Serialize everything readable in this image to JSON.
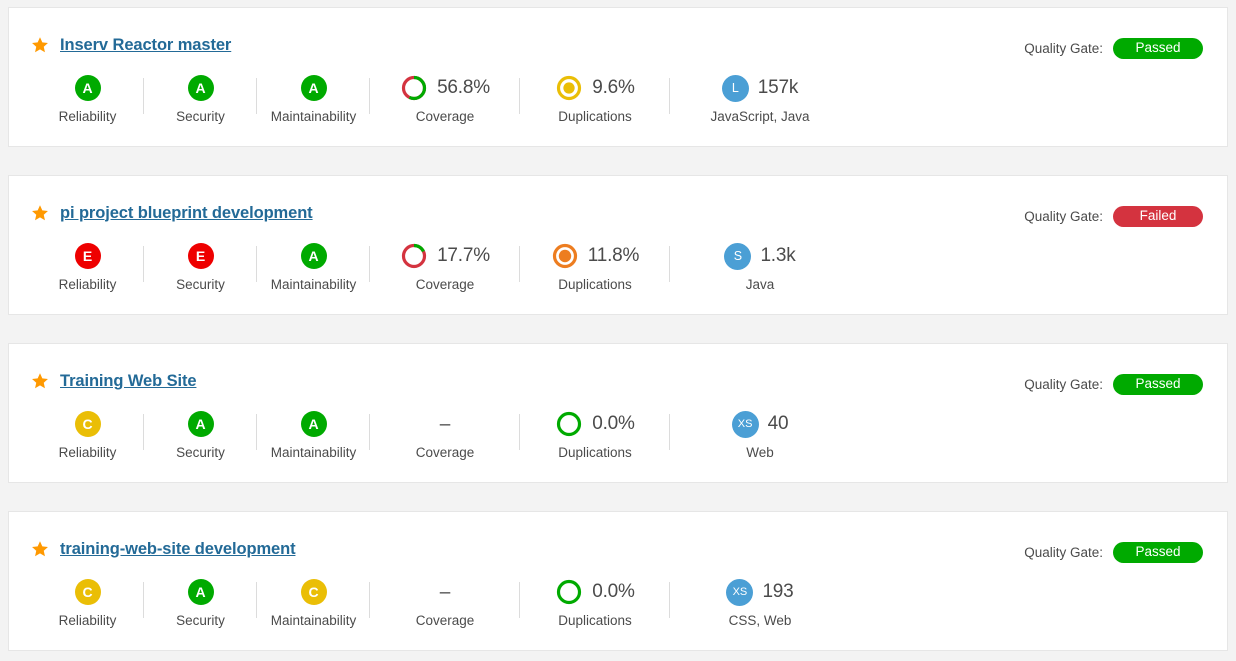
{
  "page": {
    "background_color": "#f3f3f3",
    "quality_gate_label": "Quality Gate:"
  },
  "colors": {
    "rating_a": "#00aa00",
    "rating_c": "#eabe06",
    "rating_e": "#ee0000",
    "gate_passed": "#00aa00",
    "gate_failed": "#d4333f",
    "link": "#236a97",
    "star": "#f90",
    "language_badge": "#4b9fd5",
    "coverage_good": "#00aa00",
    "coverage_bad": "#d4333f",
    "dup_low": "#eabe06",
    "dup_mid": "#ed7d20",
    "dup_none": "#00aa00"
  },
  "labels": {
    "reliability": "Reliability",
    "security": "Security",
    "maintainability": "Maintainability",
    "coverage": "Coverage",
    "duplications": "Duplications",
    "no_data": "–"
  },
  "projects": [
    {
      "name": "Inserv Reactor master",
      "favorite": true,
      "quality_gate": "Passed",
      "quality_gate_state": "passed",
      "reliability": "A",
      "security": "A",
      "maintainability": "A",
      "coverage": "56.8%",
      "coverage_pct": 56.8,
      "duplications": "9.6%",
      "duplications_pct": 9.6,
      "size_badge": "L",
      "ncloc": "157k",
      "languages": "JavaScript, Java"
    },
    {
      "name": "pi project blueprint development",
      "favorite": true,
      "quality_gate": "Failed",
      "quality_gate_state": "failed",
      "reliability": "E",
      "security": "E",
      "maintainability": "A",
      "coverage": "17.7%",
      "coverage_pct": 17.7,
      "duplications": "11.8%",
      "duplications_pct": 11.8,
      "size_badge": "S",
      "ncloc": "1.3k",
      "languages": "Java"
    },
    {
      "name": "Training Web Site",
      "favorite": true,
      "quality_gate": "Passed",
      "quality_gate_state": "passed",
      "reliability": "C",
      "security": "A",
      "maintainability": "A",
      "coverage": "–",
      "coverage_pct": null,
      "duplications": "0.0%",
      "duplications_pct": 0.0,
      "size_badge": "XS",
      "ncloc": "40",
      "languages": "Web"
    },
    {
      "name": "training-web-site development",
      "favorite": true,
      "quality_gate": "Passed",
      "quality_gate_state": "passed",
      "reliability": "C",
      "security": "A",
      "maintainability": "C",
      "coverage": "–",
      "coverage_pct": null,
      "duplications": "0.0%",
      "duplications_pct": 0.0,
      "size_badge": "XS",
      "ncloc": "193",
      "languages": "CSS, Web"
    }
  ]
}
